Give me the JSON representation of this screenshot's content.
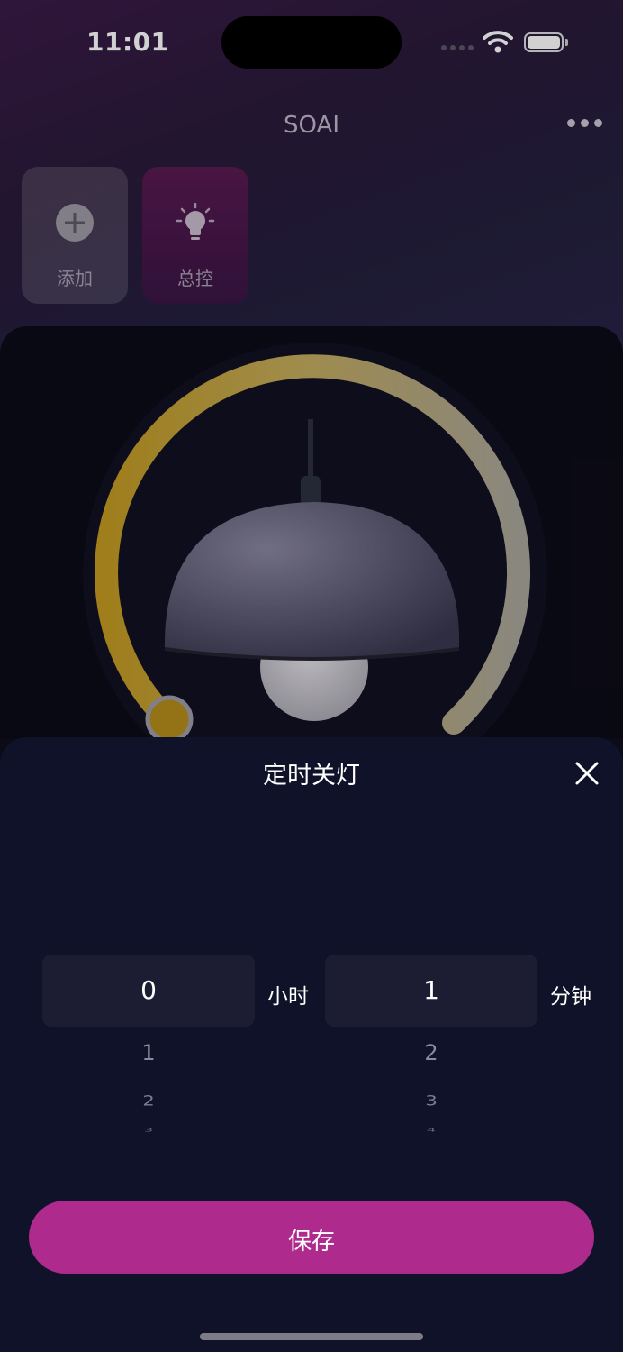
{
  "status_bar": {
    "time": "11:01"
  },
  "header": {
    "title": "SOAI",
    "more_icon": "more-dots-icon"
  },
  "tiles": [
    {
      "label": "添加",
      "icon": "plus-circle-icon"
    },
    {
      "label": "总控",
      "icon": "lightbulb-icon"
    }
  ],
  "colors": {
    "accent": "#ae2b8d",
    "sheet_bg": "#10122a",
    "arc_start": "#c7a02a",
    "arc_end": "#a6a39a"
  },
  "timer_sheet": {
    "title": "定时关灯",
    "hours": {
      "selected": "0",
      "unit": "小时",
      "next": [
        "1",
        "2",
        "3"
      ]
    },
    "minutes": {
      "selected": "1",
      "unit": "分钟",
      "next": [
        "2",
        "3",
        "4"
      ]
    },
    "save_label": "保存"
  }
}
